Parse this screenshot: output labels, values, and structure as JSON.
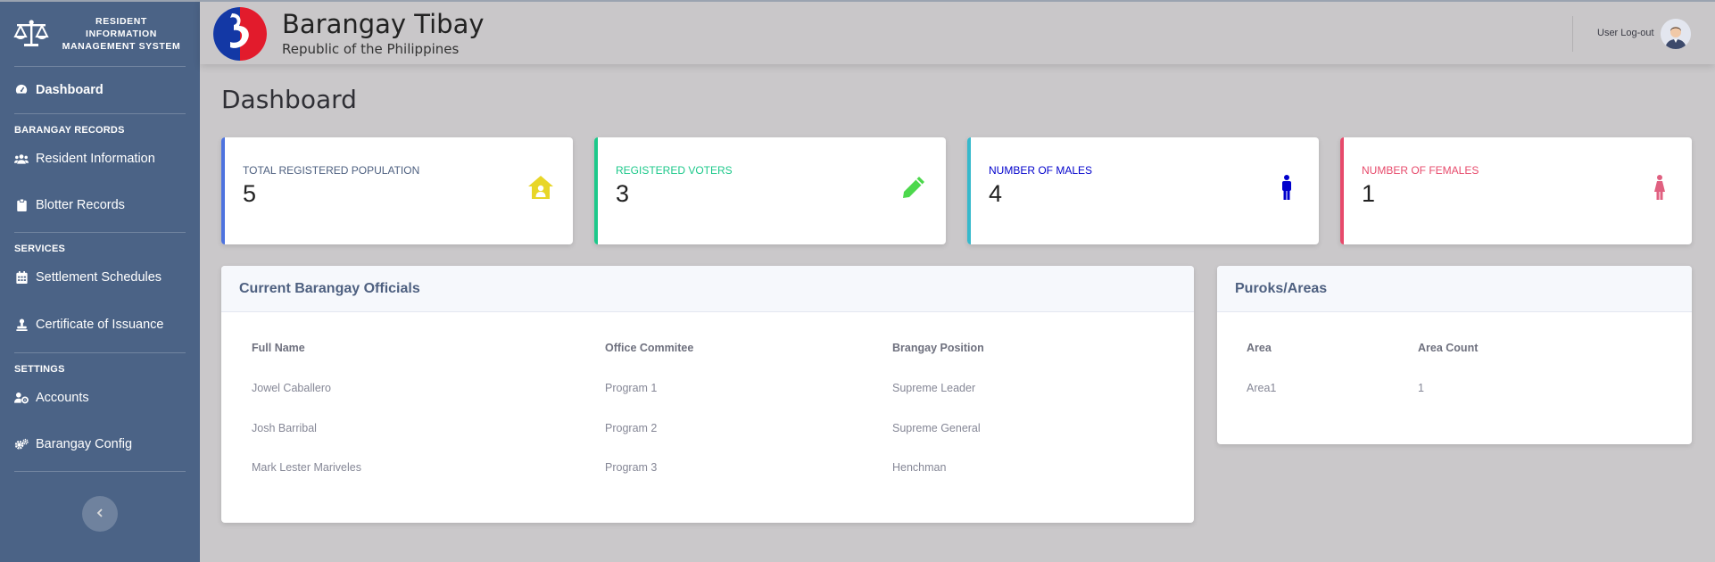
{
  "sidebar": {
    "brand_line1": "RESIDENT INFORMATION",
    "brand_line2": "MANAGEMENT SYSTEM",
    "dashboard": "Dashboard",
    "heading_records": "BARANGAY RECORDS",
    "resident_info": "Resident Information",
    "blotter": "Blotter Records",
    "heading_services": "SERVICES",
    "settlement": "Settlement Schedules",
    "certificate": "Certificate of Issuance",
    "heading_settings": "SETTINGS",
    "accounts": "Accounts",
    "config": "Barangay Config",
    "toggle_icon": "chevron-left-icon"
  },
  "topbar": {
    "title": "Barangay Tibay",
    "subtitle": "Republic of the Philippines",
    "logout": "User Log-out"
  },
  "main": {
    "page_title": "Dashboard",
    "stats": [
      {
        "label": "TOTAL REGISTERED POPULATION",
        "value": "5",
        "color": "#4e73df",
        "label_color": "#4e6080",
        "icon": "home-user-icon",
        "icon_color": "#e8d628"
      },
      {
        "label": "REGISTERED VOTERS",
        "value": "3",
        "color": "#1cc88a",
        "label_color": "#1cc88a",
        "icon": "pencil-icon",
        "icon_color": "#4cd84c"
      },
      {
        "label": "NUMBER OF MALES",
        "value": "4",
        "color": "#36b9cc",
        "label_color": "#0000cc",
        "icon": "male-icon",
        "icon_color": "#0000cc"
      },
      {
        "label": "NUMBER OF FEMALES",
        "value": "1",
        "color": "#e74a6b",
        "label_color": "#e74a6b",
        "icon": "female-icon",
        "icon_color": "#e06080"
      }
    ],
    "officials": {
      "title": "Current Barangay Officials",
      "headers": [
        "Full Name",
        "Office Commitee",
        "Brangay Position"
      ],
      "rows": [
        [
          "Jowel Caballero",
          "Program 1",
          "Supreme Leader"
        ],
        [
          "Josh Barribal",
          "Program 2",
          "Supreme General"
        ],
        [
          "Mark Lester Mariveles",
          "Program 3",
          "Henchman"
        ]
      ]
    },
    "puroks": {
      "title": "Puroks/Areas",
      "headers": [
        "Area",
        "Area Count"
      ],
      "rows": [
        [
          "Area1",
          "1"
        ]
      ]
    }
  }
}
